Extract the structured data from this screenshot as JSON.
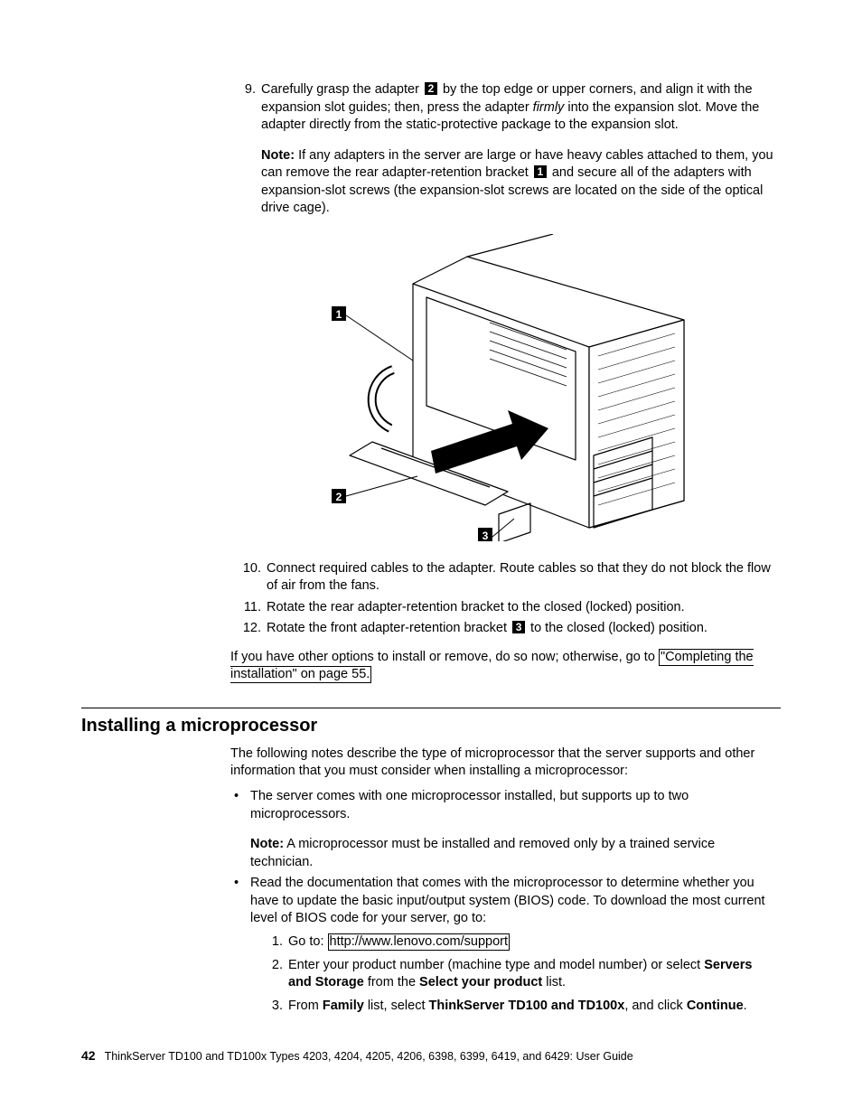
{
  "steps_top": [
    {
      "n": "9.",
      "text_a": "Carefully grasp the adapter ",
      "callout_a": "2",
      "text_b": " by the top edge or upper corners, and align it with the expansion slot guides; then, press the adapter ",
      "italic": "firmly",
      "text_c": " into the expansion slot. Move the adapter directly from the static-protective package to the expansion slot.",
      "note_label": "Note:",
      "note_a": "  If any adapters in the server are large or have heavy cables attached to them, you can remove the rear adapter-retention bracket ",
      "note_callout": "1",
      "note_b": " and secure all of the adapters with expansion-slot screws (the expansion-slot screws are located on the side of the optical drive cage)."
    }
  ],
  "figure_callouts": {
    "c1": "1",
    "c2": "2",
    "c3": "3"
  },
  "steps_bottom": [
    {
      "n": "10.",
      "text": "Connect required cables to the adapter. Route cables so that they do not block the flow of air from the fans."
    },
    {
      "n": "11.",
      "text": "Rotate the rear adapter-retention bracket to the closed (locked) position."
    },
    {
      "n": "12.",
      "text_a": "Rotate the front adapter-retention bracket ",
      "callout": "3",
      "text_b": " to the closed (locked) position."
    }
  ],
  "post_steps": {
    "lead": "If you have other options to install or remove, do so now; otherwise, go to ",
    "link": "\"Completing the installation\" on page 55."
  },
  "section_heading": "Installing a microprocessor",
  "section_intro": "The following notes describe the type of microprocessor that the server supports and other information that you must consider when installing a microprocessor:",
  "bullets": [
    {
      "text": "The server comes with one microprocessor installed, but supports up to two microprocessors.",
      "note_label": "Note:",
      "note_text": "  A microprocessor must be installed and removed only by a trained service technician."
    },
    {
      "text": "Read the documentation that comes with the microprocessor to determine whether you have to update the basic input/output system (BIOS) code. To download the most current level of BIOS code for your server, go to:",
      "sub": [
        {
          "n": "1.",
          "pre": "Go to: ",
          "link": "http://www.lenovo.com/support"
        },
        {
          "n": "2.",
          "plain_a": "Enter your product number (machine type and model number) or select ",
          "bold_a": "Servers and Storage",
          "plain_b": " from the ",
          "bold_b": "Select your product",
          "plain_c": " list."
        },
        {
          "n": "3.",
          "plain_a": "From ",
          "bold_a": "Family",
          "plain_b": " list, select ",
          "bold_b": "ThinkServer TD100 and TD100x",
          "plain_c": ", and click ",
          "bold_c": "Continue",
          "plain_d": "."
        }
      ]
    }
  ],
  "footer": {
    "page": "42",
    "text": "ThinkServer TD100 and TD100x Types 4203, 4204, 4205, 4206, 6398, 6399, 6419, and 6429:  User Guide"
  }
}
